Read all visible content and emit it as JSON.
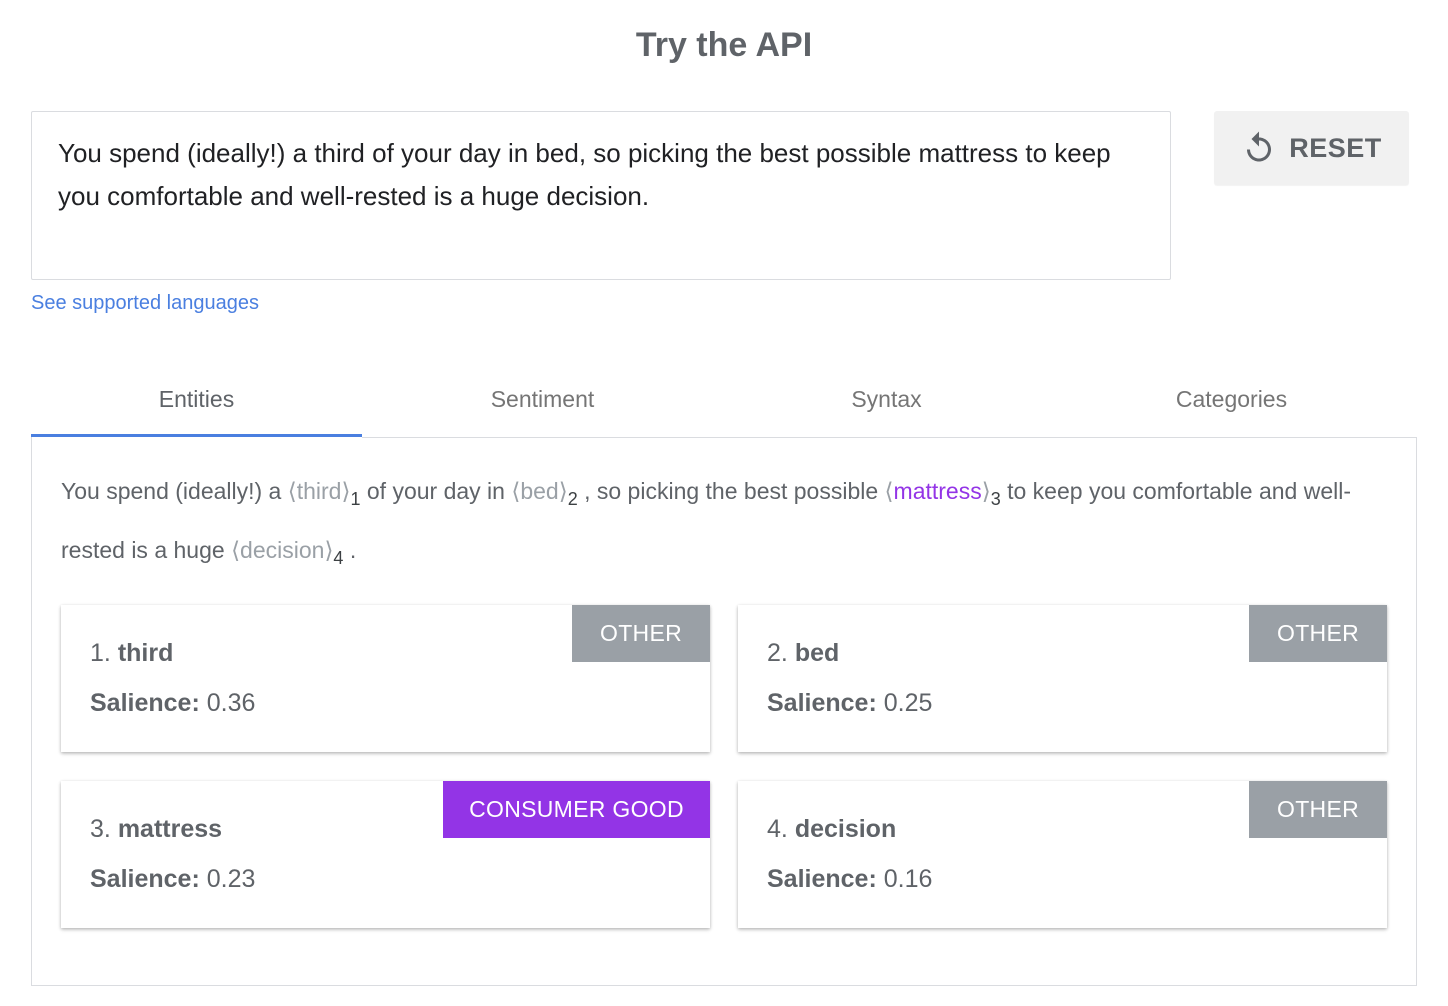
{
  "page": {
    "title": "Try the API"
  },
  "input": {
    "value": "You spend (ideally!) a third of your day in bed, so picking the best possible mattress to keep you comfortable and well-rested is a huge decision."
  },
  "reset": {
    "label": "RESET",
    "icon": "reset-icon"
  },
  "link": {
    "label": "See supported languages"
  },
  "tabs": [
    {
      "label": "Entities",
      "active": true
    },
    {
      "label": "Sentiment",
      "active": false
    },
    {
      "label": "Syntax",
      "active": false
    },
    {
      "label": "Categories",
      "active": false
    }
  ],
  "annotated": {
    "t1": "You spend (ideally!) a ",
    "e1": "third",
    "n1": "1",
    "t2": " of your day in ",
    "e2": "bed",
    "n2": "2",
    "t3": " , so picking the best possible ",
    "e3": "mattress",
    "n3": "3",
    "t4": " to keep you comfortable and well-rested is a huge ",
    "e4": "decision",
    "n4": "4",
    "t5": " ."
  },
  "entities": [
    {
      "index": "1.",
      "name": "third",
      "salience_label": "Salience:",
      "salience": "0.36",
      "type": "OTHER",
      "color": "#9aa0a6"
    },
    {
      "index": "2.",
      "name": "bed",
      "salience_label": "Salience:",
      "salience": "0.25",
      "type": "OTHER",
      "color": "#9aa0a6"
    },
    {
      "index": "3.",
      "name": "mattress",
      "salience_label": "Salience:",
      "salience": "0.23",
      "type": "CONSUMER GOOD",
      "color": "#9334e6"
    },
    {
      "index": "4.",
      "name": "decision",
      "salience_label": "Salience:",
      "salience": "0.16",
      "type": "OTHER",
      "color": "#9aa0a6"
    }
  ],
  "colors": {
    "accent": "#4a7fe0",
    "other": "#9aa0a6",
    "consumer_good": "#9334e6"
  }
}
